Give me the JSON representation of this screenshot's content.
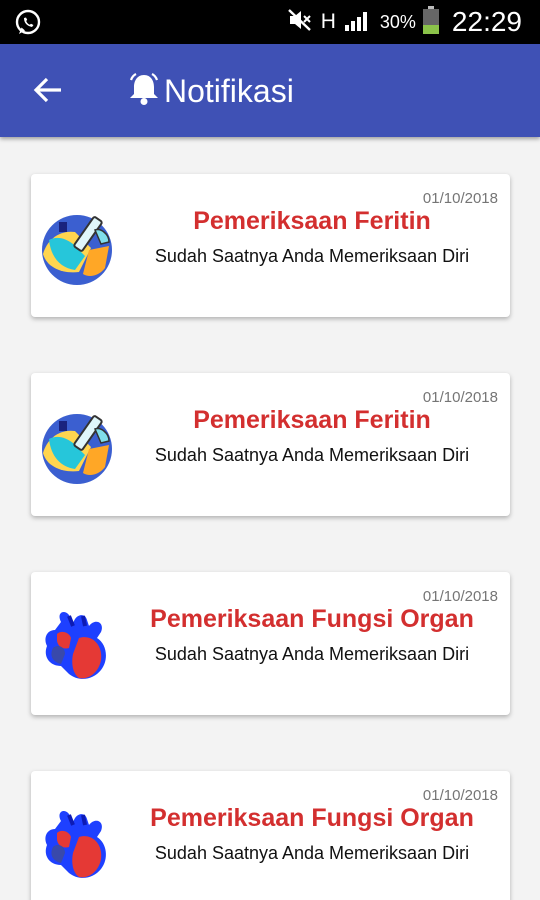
{
  "status_bar": {
    "network": "H",
    "battery": "30%",
    "time": "22:29"
  },
  "app_bar": {
    "title": "Notifikasi"
  },
  "notifications": [
    {
      "date": "01/10/2018",
      "title": "Pemeriksaan Feritin",
      "message": "Sudah Saatnya Anda Memeriksaan Diri",
      "icon": "blood-test-icon"
    },
    {
      "date": "01/10/2018",
      "title": "Pemeriksaan Feritin",
      "message": "Sudah Saatnya Anda Memeriksaan Diri",
      "icon": "blood-test-icon"
    },
    {
      "date": "01/10/2018",
      "title": "Pemeriksaan Fungsi Organ",
      "message": "Sudah Saatnya Anda Memeriksaan Diri",
      "icon": "heart-icon"
    },
    {
      "date": "01/10/2018",
      "title": "Pemeriksaan Fungsi Organ",
      "message": "Sudah Saatnya Anda Memeriksaan Diri",
      "icon": "heart-icon"
    }
  ],
  "colors": {
    "app_bar": "#3f51b5",
    "title_red": "#d32f2f",
    "background": "#f3f3f3"
  }
}
